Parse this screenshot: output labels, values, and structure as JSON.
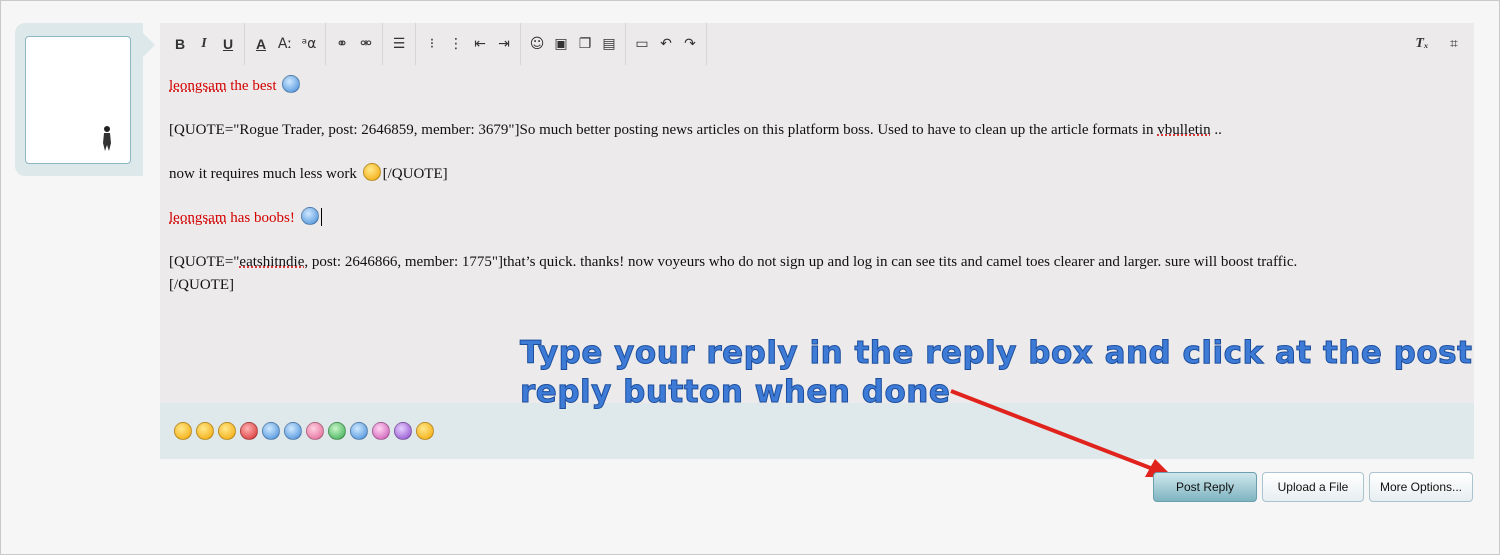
{
  "editor": {
    "lines": {
      "l1_user": "leongsam",
      "l1_rest": " the best ",
      "l2": "[QUOTE=\"Rogue Trader, post: 2646859, member: 3679\"]So much better posting news articles on this platform boss. Used to have to clean up the article formats in ",
      "l2_link": "vbulletin",
      "l2_end": " ..",
      "l3_pre": "now it requires much less work ",
      "l3_post": "[/QUOTE]",
      "l4_user": "leongsam",
      "l4_rest": " has boobs! ",
      "l5_pre": "[QUOTE=\"",
      "l5_link": "eatshitndie",
      "l5_rest": ", post: 2646866, member: 1775\"]that’s quick. thanks! now voyeurs who do not sign up and log in can see tits and camel toes clearer and larger. sure will boost traffic.",
      "l6": "[/QUOTE]"
    }
  },
  "toolbar": {
    "bold": "B",
    "italic": "I",
    "underline": "U",
    "font_color": "A",
    "font_size": "Aː",
    "font_family": "ᵃα"
  },
  "annotation": {
    "line1": "Type your reply in the reply box and click at the post",
    "line2": "reply button when done"
  },
  "buttons": {
    "post_reply": "Post Reply",
    "upload": "Upload a File",
    "more": "More Options..."
  },
  "colors": {
    "accent": "#7eb4c1",
    "annotation": "#3d7bd6",
    "arrow": "#e0231c",
    "username": "#d40000"
  }
}
